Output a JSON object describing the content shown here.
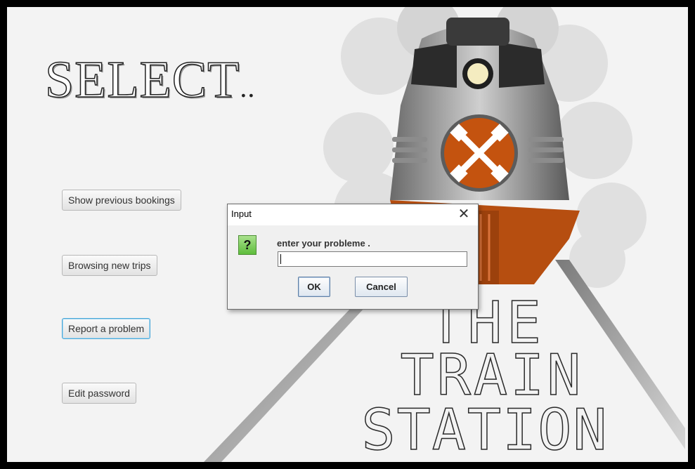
{
  "heading": {
    "text": "SELECT",
    "dots": ".."
  },
  "menu": {
    "show_previous": "Show previous bookings",
    "browse_new": "Browsing new trips",
    "report_problem": "Report a problem",
    "edit_password": "Edit password"
  },
  "poster": {
    "line1": "THE",
    "line2": "TRAIN",
    "line3": "STATION"
  },
  "dialog": {
    "title": "Input",
    "close_symbol": "✕",
    "icon_symbol": "?",
    "message": "enter your probleme .",
    "input_value": "",
    "ok_label": "OK",
    "cancel_label": "Cancel"
  },
  "colors": {
    "accent": "#c4530f",
    "focus": "#4aa7d8",
    "dialog_bg": "#f0f0f0"
  }
}
